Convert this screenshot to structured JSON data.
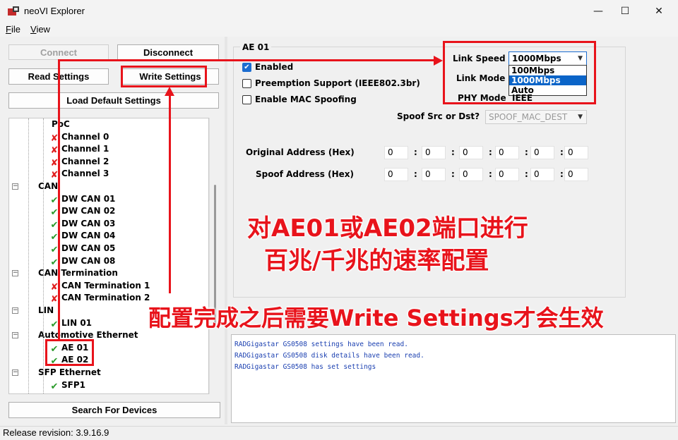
{
  "window": {
    "title": "neoVI Explorer",
    "minimize_glyph": "—",
    "maximize_glyph": "☐",
    "close_glyph": "✕"
  },
  "menu": {
    "file_first": "F",
    "file_rest": "ile",
    "view_first": "V",
    "view_rest": "iew"
  },
  "buttons": {
    "connect": "Connect",
    "disconnect": "Disconnect",
    "read_settings": "Read Settings",
    "write_settings": "Write Settings",
    "load_default": "Load Default Settings",
    "search_devices": "Search For Devices"
  },
  "tree": {
    "items": [
      {
        "label": "PoC",
        "icon": "none"
      },
      {
        "label": "Channel 0",
        "icon": "x-icon"
      },
      {
        "label": "Channel 1",
        "icon": "x-icon"
      },
      {
        "label": "Channel 2",
        "icon": "x-icon"
      },
      {
        "label": "Channel 3",
        "icon": "x-icon"
      },
      {
        "label": "CAN",
        "icon": "collapse"
      },
      {
        "label": "DW CAN 01",
        "icon": "check-icon"
      },
      {
        "label": "DW CAN 02",
        "icon": "check-icon"
      },
      {
        "label": "DW CAN 03",
        "icon": "check-icon"
      },
      {
        "label": "DW CAN 04",
        "icon": "check-icon"
      },
      {
        "label": "DW CAN 05",
        "icon": "check-icon"
      },
      {
        "label": "DW CAN 08",
        "icon": "check-icon"
      },
      {
        "label": "CAN Termination",
        "icon": "collapse"
      },
      {
        "label": "CAN Termination 1",
        "icon": "x-icon"
      },
      {
        "label": "CAN Termination 2",
        "icon": "x-icon"
      },
      {
        "label": "LIN",
        "icon": "collapse"
      },
      {
        "label": "LIN 01",
        "icon": "check-icon"
      },
      {
        "label": "Automotive Ethernet",
        "icon": "collapse"
      },
      {
        "label": "AE 01",
        "icon": "check-icon"
      },
      {
        "label": "AE 02",
        "icon": "check-icon"
      },
      {
        "label": "SFP Ethernet",
        "icon": "collapse"
      },
      {
        "label": "SFP1",
        "icon": "check-icon"
      }
    ],
    "collapse_glyph": "−",
    "check_glyph": "✔",
    "x_glyph": "✘"
  },
  "panel": {
    "group_title": "AE 01",
    "enabled_label": "Enabled",
    "enabled_checked": true,
    "preemption_label": "Preemption Support (IEEE802.3br)",
    "spoofing_label": "Enable MAC Spoofing",
    "link_speed_label": "Link Speed",
    "link_speed_value": "1000Mbps",
    "link_speed_options": [
      "100Mbps",
      "1000Mbps",
      "Auto"
    ],
    "link_speed_selected": "1000Mbps",
    "link_mode_label": "Link Mode",
    "phy_mode_label": "PHY Mode",
    "phy_mode_value": "IEEE",
    "spoof_label": "Spoof Src or Dst?",
    "spoof_value": "SPOOF_MAC_DEST",
    "original_address_label": "Original Address (Hex)",
    "original_address": [
      "0",
      "0",
      "0",
      "0",
      "0",
      "0"
    ],
    "spoof_address_label": "Spoof Address (Hex)",
    "spoof_address": [
      "0",
      "0",
      "0",
      "0",
      "0",
      "0"
    ],
    "colon": ":"
  },
  "log": {
    "lines": [
      "RADGigastar GS0508 settings have been read.",
      "RADGigastar GS0508 disk details have been read.",
      "RADGigastar GS0508 has set settings"
    ]
  },
  "status": {
    "text": "Release revision: 3.9.16.9"
  },
  "annotations": {
    "note1_line1": "对AE01或AE02端口进行",
    "note1_line2": "百兆/千兆的速率配置",
    "note2": "配置完成之后需要Write Settings才会生效",
    "color": "#e8131b"
  }
}
